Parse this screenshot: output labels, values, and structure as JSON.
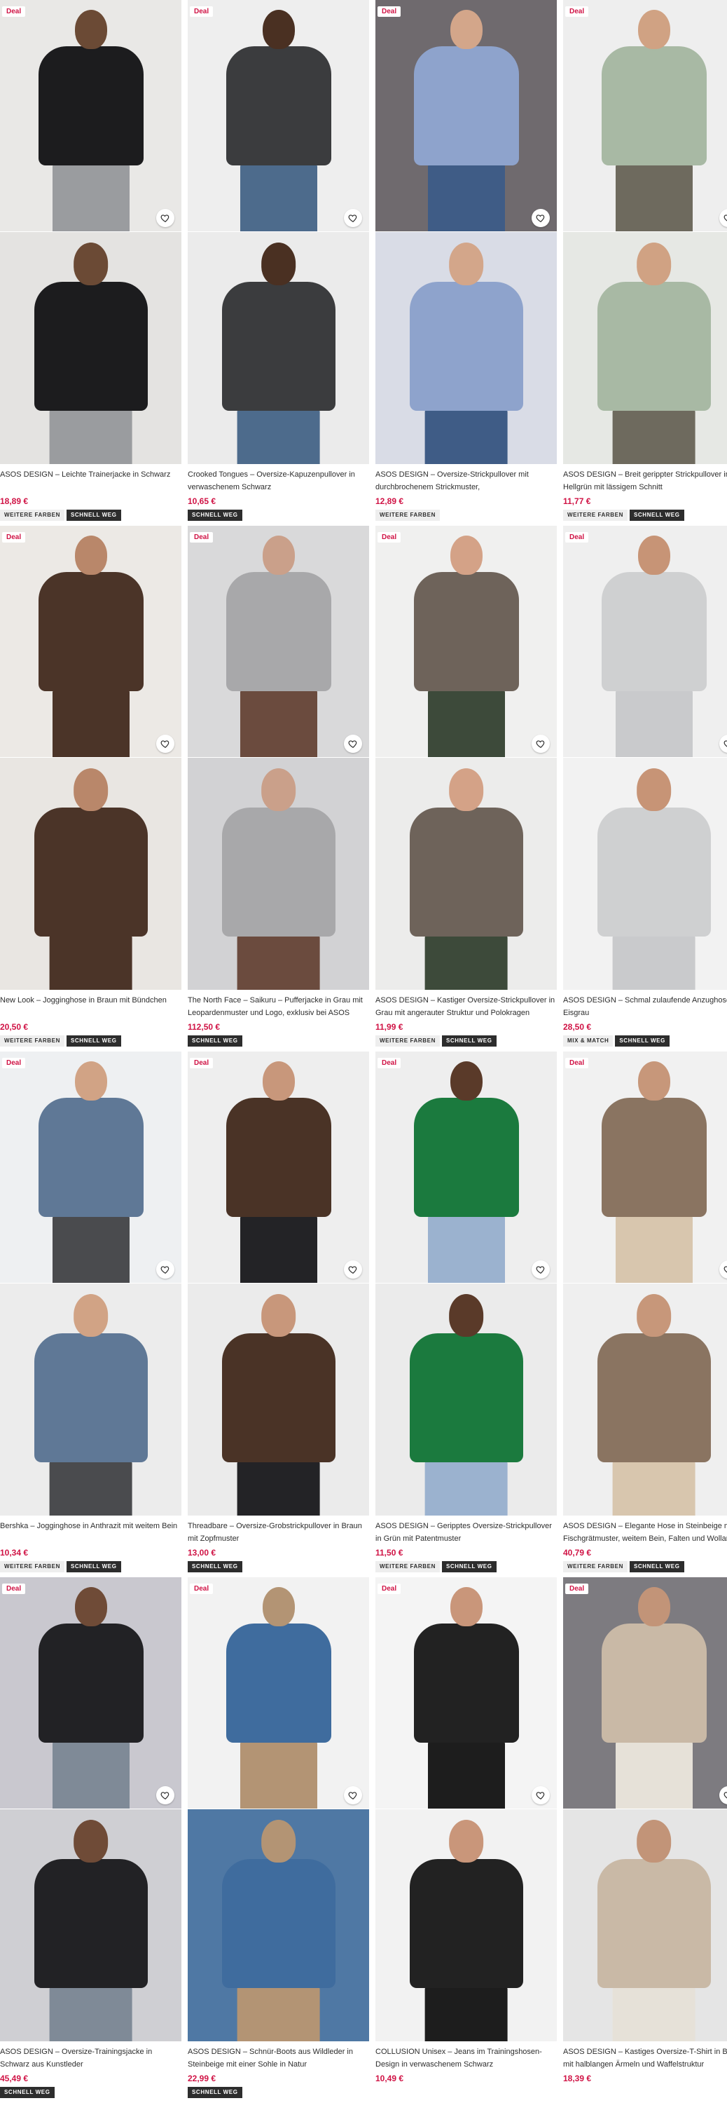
{
  "labels": {
    "deal": "Deal",
    "more_colors": "WEITERE FARBEN",
    "selling_fast": "SCHNELL WEG",
    "mix_match": "MIX & MATCH"
  },
  "icons": {
    "wishlist": "heart-icon"
  },
  "colors": {
    "price": "#d01345",
    "tag_dark": "#2d2d2d",
    "tag_light": "#eeeeee"
  },
  "products": [
    {
      "deal": true,
      "title": "ASOS DESIGN – Leichte Trainerjacke in Schwarz",
      "price": "18,89 €",
      "tags": [
        "WEITERE FARBEN",
        "SCHNELL WEG"
      ]
    },
    {
      "deal": true,
      "title": "Crooked Tongues – Oversize-Kapuzenpullover in verwaschenem Schwarz",
      "price": "10,65 €",
      "tags": [
        "SCHNELL WEG"
      ]
    },
    {
      "deal": true,
      "title": "ASOS DESIGN – Oversize-Strickpullover mit durchbrochenem Strickmuster, Rundhalsausschnitt…",
      "price": "12,89 €",
      "tags": [
        "WEITERE FARBEN"
      ]
    },
    {
      "deal": true,
      "title": "ASOS DESIGN – Breit gerippter Strickpullover in Hellgrün mit lässigem Schnitt",
      "price": "11,77 €",
      "tags": [
        "WEITERE FARBEN",
        "SCHNELL WEG"
      ]
    },
    {
      "deal": true,
      "title": "New Look – Jogginghose in Braun mit Bündchen",
      "price": "20,50 €",
      "tags": [
        "WEITERE FARBEN",
        "SCHNELL WEG"
      ]
    },
    {
      "deal": true,
      "title": "The North Face – Saikuru – Pufferjacke in Grau mit Leopardenmuster und Logo, exklusiv bei ASOS",
      "price": "112,50 €",
      "tags": [
        "SCHNELL WEG"
      ]
    },
    {
      "deal": true,
      "title": "ASOS DESIGN – Kastiger Oversize-Strickpullover in Grau mit angerauter Struktur und Polokragen",
      "price": "11,99 €",
      "tags": [
        "WEITERE FARBEN",
        "SCHNELL WEG"
      ]
    },
    {
      "deal": true,
      "title": "ASOS DESIGN – Schmal zulaufende Anzughose in Eisgrau",
      "price": "28,50 €",
      "tags": [
        "MIX & MATCH",
        "SCHNELL WEG"
      ]
    },
    {
      "deal": true,
      "title": "Bershka – Jogginghose in Anthrazit mit weitem Bein",
      "price": "10,34 €",
      "tags": [
        "WEITERE FARBEN",
        "SCHNELL WEG"
      ]
    },
    {
      "deal": true,
      "title": "Threadbare – Oversize-Grobstrickpullover in Braun mit Zopfmuster",
      "price": "13,00 €",
      "tags": [
        "SCHNELL WEG"
      ]
    },
    {
      "deal": true,
      "title": "ASOS DESIGN – Geripptes Oversize-Strickpullover in Grün mit Patentmuster",
      "price": "11,50 €",
      "tags": [
        "WEITERE FARBEN",
        "SCHNELL WEG"
      ]
    },
    {
      "deal": true,
      "title": "ASOS DESIGN – Elegante Hose in Steinbeige mit Fischgrätmuster, weitem Bein, Falten und Wollanteil",
      "price": "40,79 €",
      "tags": [
        "WEITERE FARBEN",
        "SCHNELL WEG"
      ]
    },
    {
      "deal": true,
      "title": "ASOS DESIGN – Oversize-Trainingsjacke in Schwarz aus Kunstleder",
      "price": "45,49 €",
      "tags": [
        "SCHNELL WEG"
      ]
    },
    {
      "deal": true,
      "title": "ASOS DESIGN – Schnür-Boots aus Wildleder in Steinbeige mit einer Sohle in Natur",
      "price": "22,99 €",
      "tags": [
        "SCHNELL WEG"
      ]
    },
    {
      "deal": true,
      "title": "COLLUSION Unisex – Jeans im Trainingshosen-Design in verwaschenem Schwarz",
      "price": "10,49 €",
      "tags": []
    },
    {
      "deal": true,
      "title": "ASOS DESIGN – Kastiges Oversize-T-Shirt in Beige mit halblangen Ärmeln und Waffelstruktur",
      "price": "18,39 €",
      "tags": []
    }
  ]
}
